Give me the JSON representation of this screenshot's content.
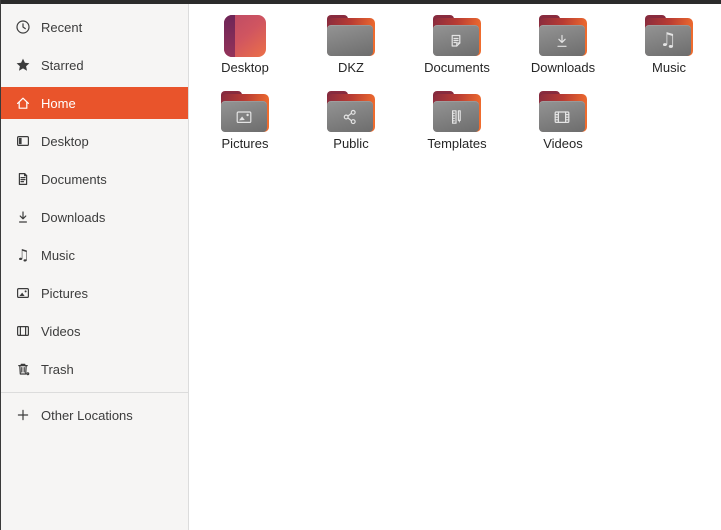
{
  "colors": {
    "accent_orange": "#E9542B",
    "sidebar_bg": "#F6F5F4",
    "divider": "#DCDCDC",
    "window_edge": "#2B2B2B",
    "folder_front_gray": "#7A7A7A",
    "folder_back_orange": "#EF6C2E",
    "folder_tab_maroon": "#7B2840"
  },
  "sidebar": {
    "items": [
      {
        "id": "recent",
        "label": "Recent",
        "icon": "clock-icon",
        "selected": false
      },
      {
        "id": "starred",
        "label": "Starred",
        "icon": "star-icon",
        "selected": false
      },
      {
        "id": "home",
        "label": "Home",
        "icon": "home-icon",
        "selected": true
      },
      {
        "id": "desktop",
        "label": "Desktop",
        "icon": "desktop-icon",
        "selected": false
      },
      {
        "id": "documents",
        "label": "Documents",
        "icon": "document-icon",
        "selected": false
      },
      {
        "id": "downloads",
        "label": "Downloads",
        "icon": "download-icon",
        "selected": false
      },
      {
        "id": "music",
        "label": "Music",
        "icon": "music-note-icon",
        "selected": false
      },
      {
        "id": "pictures",
        "label": "Pictures",
        "icon": "picture-icon",
        "selected": false
      },
      {
        "id": "videos",
        "label": "Videos",
        "icon": "film-icon",
        "selected": false
      },
      {
        "id": "trash",
        "label": "Trash",
        "icon": "trash-icon",
        "selected": false
      }
    ],
    "bottom_items": [
      {
        "id": "other-locations",
        "label": "Other Locations",
        "icon": "plus-icon"
      }
    ]
  },
  "files": {
    "view": "icon-grid",
    "items": [
      {
        "id": "desktop",
        "label": "Desktop",
        "icon": "desktop-special-icon",
        "emblem": null
      },
      {
        "id": "dkz",
        "label": "DKZ",
        "icon": "folder-icon",
        "emblem": null
      },
      {
        "id": "documents",
        "label": "Documents",
        "icon": "folder-icon",
        "emblem": "document-emblem"
      },
      {
        "id": "downloads",
        "label": "Downloads",
        "icon": "folder-icon",
        "emblem": "download-emblem"
      },
      {
        "id": "music",
        "label": "Music",
        "icon": "folder-icon",
        "emblem": "music-note-emblem"
      },
      {
        "id": "pictures",
        "label": "Pictures",
        "icon": "folder-icon",
        "emblem": "picture-emblem"
      },
      {
        "id": "public",
        "label": "Public",
        "icon": "folder-icon",
        "emblem": "share-emblem"
      },
      {
        "id": "templates",
        "label": "Templates",
        "icon": "folder-icon",
        "emblem": "ruler-pencil-emblem"
      },
      {
        "id": "videos",
        "label": "Videos",
        "icon": "folder-icon",
        "emblem": "film-emblem"
      }
    ]
  }
}
